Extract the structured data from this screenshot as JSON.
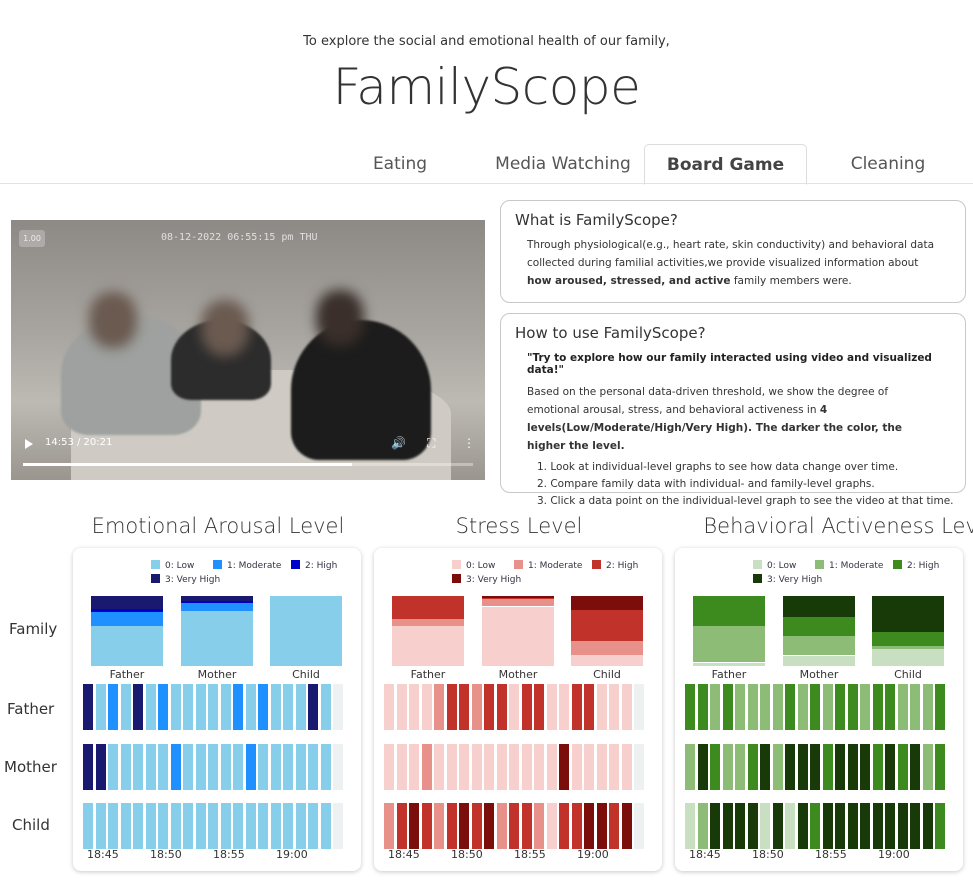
{
  "header": {
    "subtitle": "To explore the social and emotional health of our family,",
    "title": "FamilyScope"
  },
  "tabs": [
    {
      "label": "Eating"
    },
    {
      "label": "Media Watching"
    },
    {
      "label": "Board Game",
      "active": true
    },
    {
      "label": "Cleaning"
    }
  ],
  "video": {
    "overlay_timestamp": "08-12-2022 06:55:15 pm THU",
    "badge": "1.00",
    "time_display": "14:53 / 20:21",
    "progress": 0.731
  },
  "info": {
    "what_title": "What is FamilyScope?",
    "what_text_1": "Through physiological(e.g., heart rate, skin conductivity) and behavioral data collected during familial activities,we provide visualized information about ",
    "what_bold": "how aroused, stressed, and active",
    "what_text_2": " family members were.",
    "how_title": "How to use FamilyScope?",
    "how_quote": "\"Try to explore how our family interacted using video and visualized data!\"",
    "how_text_1": "Based on the personal data-driven threshold, we show the degree of emotional arousal, stress, and behavioral activeness in ",
    "how_bold": "4 levels(Low/Moderate/High/Very High). The darker the color, the higher the level.",
    "steps": [
      "1. Look at individual-level graphs to see how data change over time.",
      "2. Compare family data with individual- and family-level graphs.",
      "3. Click a data point on the individual-level graph to see the video at that time."
    ]
  },
  "row_labels": [
    "Family",
    "Father",
    "Mother",
    "Child"
  ],
  "members": [
    "Father",
    "Mother",
    "Child"
  ],
  "time_ticks": [
    "18:45",
    "18:50",
    "18:55",
    "19:00"
  ],
  "legend_labels": [
    "0: Low",
    "1: Moderate",
    "2: High",
    "3: Very High"
  ],
  "chart_data": [
    {
      "type": "heatmap",
      "title": "Emotional Arousal Level",
      "colors": [
        "#87ceeb",
        "#1e90ff",
        "#0000cd",
        "#191970"
      ],
      "family": [
        [
          0.57,
          0.2,
          0.05,
          0.18
        ],
        [
          0.78,
          0.12,
          0.03,
          0.07
        ],
        [
          1,
          0,
          0,
          0
        ]
      ],
      "individual": {
        "Father": [
          3,
          0,
          1,
          0,
          3,
          0,
          1,
          0,
          0,
          0,
          0,
          0,
          1,
          0,
          1,
          0,
          0,
          0,
          3,
          0,
          null
        ],
        "Mother": [
          3,
          3,
          0,
          0,
          0,
          0,
          0,
          1,
          0,
          0,
          0,
          0,
          0,
          1,
          0,
          0,
          0,
          0,
          0,
          0,
          null
        ],
        "Child": [
          0,
          0,
          0,
          0,
          0,
          0,
          0,
          0,
          0,
          0,
          0,
          0,
          0,
          0,
          0,
          0,
          0,
          0,
          0,
          0,
          null
        ]
      }
    },
    {
      "type": "heatmap",
      "title": "Stress Level",
      "colors": [
        "#f7d0ce",
        "#e8908a",
        "#c0322a",
        "#7b0e0a"
      ],
      "family": [
        [
          0.57,
          0.1,
          0.33,
          0
        ],
        [
          0.85,
          0.11,
          0.01,
          0.03
        ],
        [
          0.16,
          0.2,
          0.44,
          0.2
        ]
      ],
      "individual": {
        "Father": [
          0,
          0,
          0,
          0,
          1,
          2,
          2,
          1,
          2,
          2,
          0,
          2,
          2,
          0,
          0,
          2,
          2,
          0,
          0,
          0,
          null
        ],
        "Mother": [
          0,
          0,
          0,
          1,
          0,
          0,
          0,
          0,
          0,
          0,
          0,
          0,
          0,
          0,
          3,
          0,
          0,
          0,
          0,
          0,
          null
        ],
        "Child": [
          1,
          2,
          3,
          2,
          1,
          2,
          3,
          2,
          3,
          1,
          2,
          2,
          1,
          0,
          2,
          2,
          3,
          3,
          2,
          3,
          null
        ]
      }
    },
    {
      "type": "heatmap",
      "title": "Behavioral Activeness Level",
      "colors": [
        "#c9dfc2",
        "#8dbc76",
        "#3d8a1f",
        "#183a08"
      ],
      "family": [
        [
          0.05,
          0.52,
          0.43,
          0
        ],
        [
          0.15,
          0.28,
          0.27,
          0.3
        ],
        [
          0.24,
          0.04,
          0.21,
          0.51
        ]
      ],
      "individual": {
        "Father": [
          2,
          2,
          1,
          2,
          1,
          1,
          1,
          1,
          2,
          1,
          2,
          1,
          2,
          2,
          1,
          2,
          2,
          1,
          1,
          1,
          2
        ],
        "Mother": [
          1,
          3,
          2,
          1,
          1,
          2,
          3,
          1,
          3,
          3,
          3,
          2,
          3,
          3,
          3,
          2,
          3,
          2,
          3,
          1,
          2
        ],
        "Child": [
          0,
          1,
          3,
          3,
          3,
          3,
          0,
          3,
          0,
          3,
          2,
          3,
          3,
          3,
          3,
          3,
          3,
          3,
          3,
          3,
          2
        ]
      }
    }
  ]
}
